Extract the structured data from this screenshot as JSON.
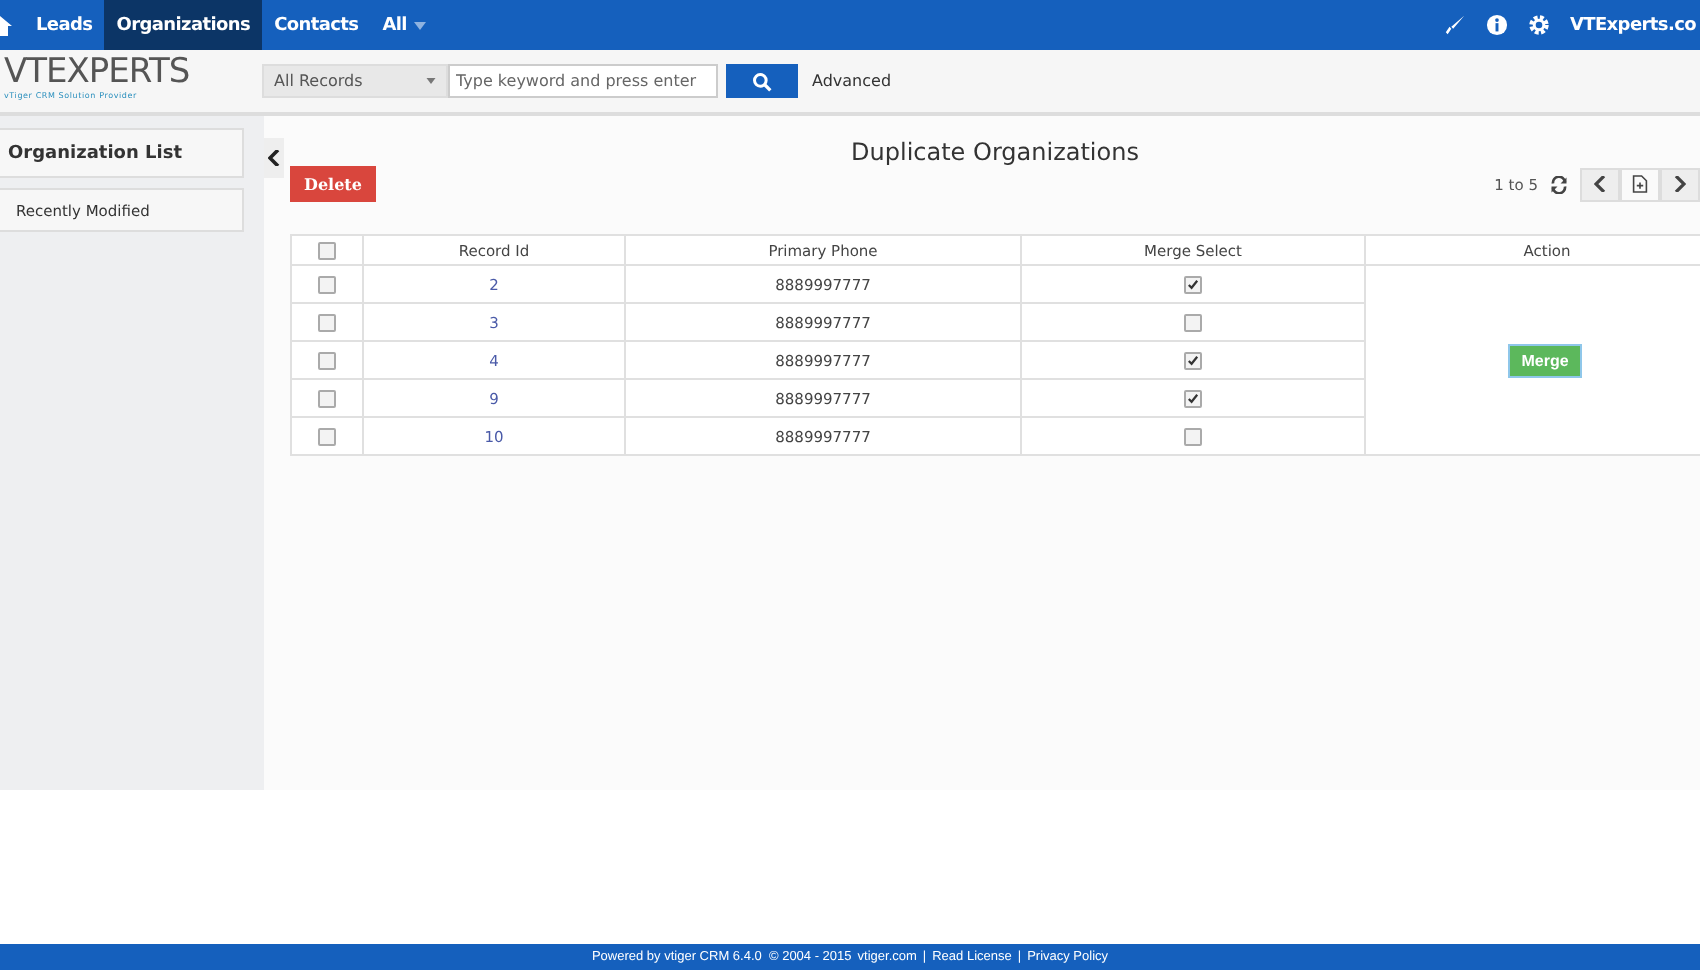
{
  "top_nav": {
    "items": [
      {
        "label": "Leads",
        "selected": false
      },
      {
        "label": "Organizations",
        "selected": true
      },
      {
        "label": "Contacts",
        "selected": false
      },
      {
        "label": "All",
        "selected": false
      }
    ],
    "user": "VTExperts.co"
  },
  "header": {
    "logo": "VTEXPERTS",
    "tagline": "vTiger CRM Solution Provider",
    "filter": "All Records",
    "search": {
      "placeholder": "Type keyword and press enter"
    },
    "advanced": "Advanced"
  },
  "sidebar": {
    "title": "Organization List",
    "items": [
      "Recently Modified"
    ]
  },
  "page": {
    "title": "Duplicate Organizations",
    "delete": "Delete",
    "range": "1 to 5"
  },
  "table": {
    "select_all_checked": false,
    "columns": [
      "Record Id",
      "Primary Phone",
      "Merge Select",
      "Action"
    ],
    "merge": "Merge",
    "rows": [
      {
        "id": "2",
        "phone": "8889997777",
        "checked": false,
        "merge": true
      },
      {
        "id": "3",
        "phone": "8889997777",
        "checked": false,
        "merge": false
      },
      {
        "id": "4",
        "phone": "8889997777",
        "checked": false,
        "merge": true
      },
      {
        "id": "9",
        "phone": "8889997777",
        "checked": false,
        "merge": true
      },
      {
        "id": "10",
        "phone": "8889997777",
        "checked": false,
        "merge": false
      }
    ]
  },
  "footer": {
    "text": "Powered by vtiger CRM 6.4.0  © 2004 - 2015",
    "links": [
      "vtiger.com",
      "Read License",
      "Privacy Policy"
    ],
    "separator": "|"
  }
}
